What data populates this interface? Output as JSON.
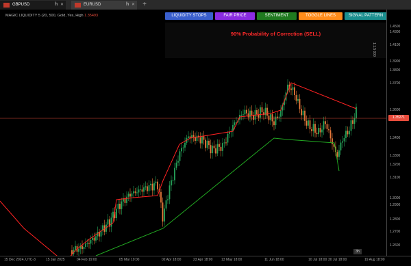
{
  "tabs": [
    {
      "label": "GBPUSD",
      "active": true
    },
    {
      "label": "EURUSD",
      "active": false
    }
  ],
  "tab_arrow": "h",
  "indicator": {
    "label": "MAGIC LIQUIDITY 5 (20, 500, Gold, Yes, High",
    "value": "1.35493"
  },
  "buttons": [
    {
      "label": "LIQUIDITY STOPS",
      "color": "#3a5fcd"
    },
    {
      "label": "FAIR PRICE",
      "color": "#8a2be2"
    },
    {
      "label": "SENTIMENT",
      "color": "#1f7a1f"
    },
    {
      "label": "TOGGLE LINES",
      "color": "#ff8c1a"
    },
    {
      "label": "SIGNAL PATTERN",
      "color": "#1a8f8f"
    }
  ],
  "signal": {
    "text": "90% Probability of Correction (SELL)",
    "color": "#ff2a2a"
  },
  "vertical_label": "1:1.5 000",
  "price_axis": {
    "ticks": [
      "1.4500",
      "1.4300",
      "1.4100",
      "1.3900",
      "1.3800",
      "1.3700",
      "1.3600",
      "1.3500",
      "1.3400",
      "1.3300",
      "1.3200",
      "1.3100",
      "1.3000",
      "1.2900",
      "1.2800",
      "1.2700",
      "1.2600"
    ],
    "current": "1.35271"
  },
  "time_axis": {
    "ticks": [
      "15 Dec 2024, UTC-3",
      "15 Jan 2025",
      "04 Feb 19:00",
      "05 Mar 19:00",
      "02 Apr 18:00",
      "23 Apr 18:00",
      "13 May 18:00",
      "11 Jun 18:00",
      "10 Jul 18:00",
      "30 Jul 18:00",
      "19 Aug 18:00"
    ]
  },
  "corner_label": "3h",
  "colors": {
    "bull": "#26a65b",
    "bear": "#e8793a",
    "resistance": "#ff2222",
    "support": "#22aa22",
    "price_line": "#e74c3c"
  }
}
